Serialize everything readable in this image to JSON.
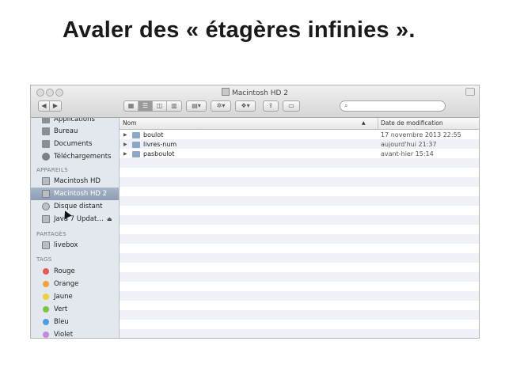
{
  "slide": {
    "title": "Avaler des « étagères infinies »."
  },
  "window": {
    "title": "Macintosh HD 2"
  },
  "sidebar": {
    "items_top": [
      {
        "label": "Applications",
        "icon": "applications-icon"
      },
      {
        "label": "Bureau",
        "icon": "desktop-icon"
      },
      {
        "label": "Documents",
        "icon": "documents-icon"
      },
      {
        "label": "Téléchargements",
        "icon": "downloads-icon"
      }
    ],
    "section_devices": "APPAREILS",
    "devices": [
      {
        "label": "Macintosh HD",
        "icon": "disk-icon"
      },
      {
        "label": "Macintosh HD 2",
        "icon": "disk-icon",
        "selected": true
      },
      {
        "label": "Disque distant",
        "icon": "remote-disk-icon"
      },
      {
        "label": "Java 7 Updat…",
        "icon": "disk-icon",
        "eject": "⏏"
      }
    ],
    "section_shared": "PARTAGÉS",
    "shared": [
      {
        "label": "livebox",
        "icon": "server-icon"
      }
    ],
    "section_tags": "TAGS",
    "tags": [
      {
        "label": "Rouge",
        "color": "#e05a5a"
      },
      {
        "label": "Orange",
        "color": "#f0a03c"
      },
      {
        "label": "Jaune",
        "color": "#e8d23c"
      },
      {
        "label": "Vert",
        "color": "#7cc447"
      },
      {
        "label": "Bleu",
        "color": "#4f9de0"
      },
      {
        "label": "Violet",
        "color": "#c28ad8"
      }
    ]
  },
  "columns": {
    "name": "Nom",
    "sort_indicator": "▲",
    "date": "Date de modification"
  },
  "files": [
    {
      "name": "boulot",
      "date": "17 novembre 2013 22:55"
    },
    {
      "name": "livres-num",
      "date": "aujourd'hui 21:37"
    },
    {
      "name": "pasboulot",
      "date": "avant-hier 15:14"
    }
  ]
}
